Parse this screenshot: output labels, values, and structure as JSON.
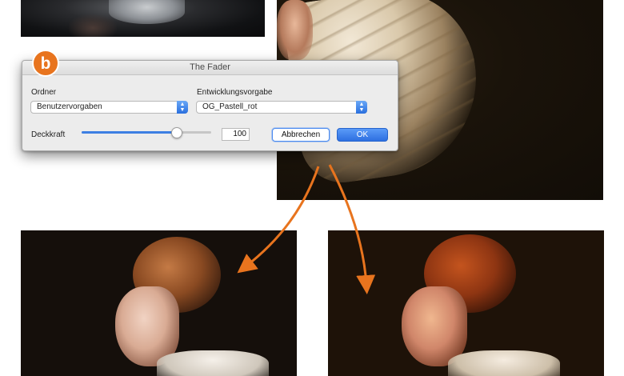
{
  "badge": {
    "letter": "b",
    "color": "#e8741e"
  },
  "dialog": {
    "title": "The Fader",
    "folder_label": "Ordner",
    "folder_value": "Benutzervorgaben",
    "preset_label": "Entwicklungsvorgabe",
    "preset_value": "OG_Pastell_rot",
    "opacity_label": "Deckkraft",
    "opacity_value": "100",
    "cancel_label": "Abbrechen",
    "ok_label": "OK",
    "accent_color": "#3d7fe3"
  },
  "annotations": {
    "arrow_color": "#e8741e"
  },
  "images": [
    {
      "name": "photo-top-left"
    },
    {
      "name": "photo-top-right"
    },
    {
      "name": "photo-bottom-left"
    },
    {
      "name": "photo-bottom-right"
    }
  ]
}
